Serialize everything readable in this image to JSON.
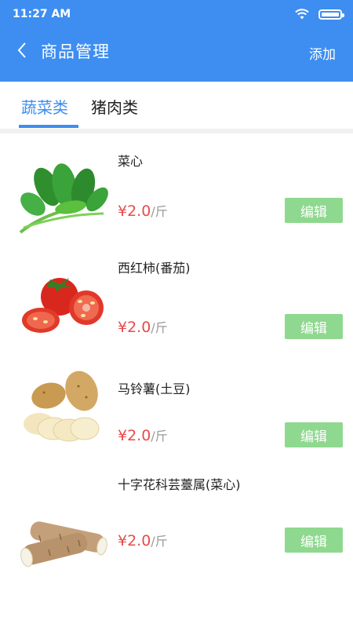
{
  "status": {
    "time": "11:27 AM"
  },
  "header": {
    "title": "商品管理",
    "add_label": "添加"
  },
  "tabs": [
    {
      "label": "蔬菜类"
    },
    {
      "label": "猪肉类"
    }
  ],
  "products": [
    {
      "name": "菜心",
      "price": "¥2.0",
      "unit": "/斤",
      "edit_label": "编辑",
      "icon": "leafy-greens-image"
    },
    {
      "name": "西红柿(番茄)",
      "price": "¥2.0",
      "unit": "/斤",
      "edit_label": "编辑",
      "icon": "tomato-image"
    },
    {
      "name": " 马铃薯(土豆)",
      "price": "¥2.0",
      "unit": "/斤",
      "edit_label": "编辑",
      "icon": "potato-image"
    },
    {
      "name": "十字花科芸薹属(菜心)",
      "price": "¥2.0",
      "unit": "/斤",
      "edit_label": "编辑",
      "icon": "yam-image"
    }
  ],
  "colors": {
    "primary": "#3d8ef0",
    "price": "#e84a4a",
    "edit_button": "#8fd88f"
  }
}
